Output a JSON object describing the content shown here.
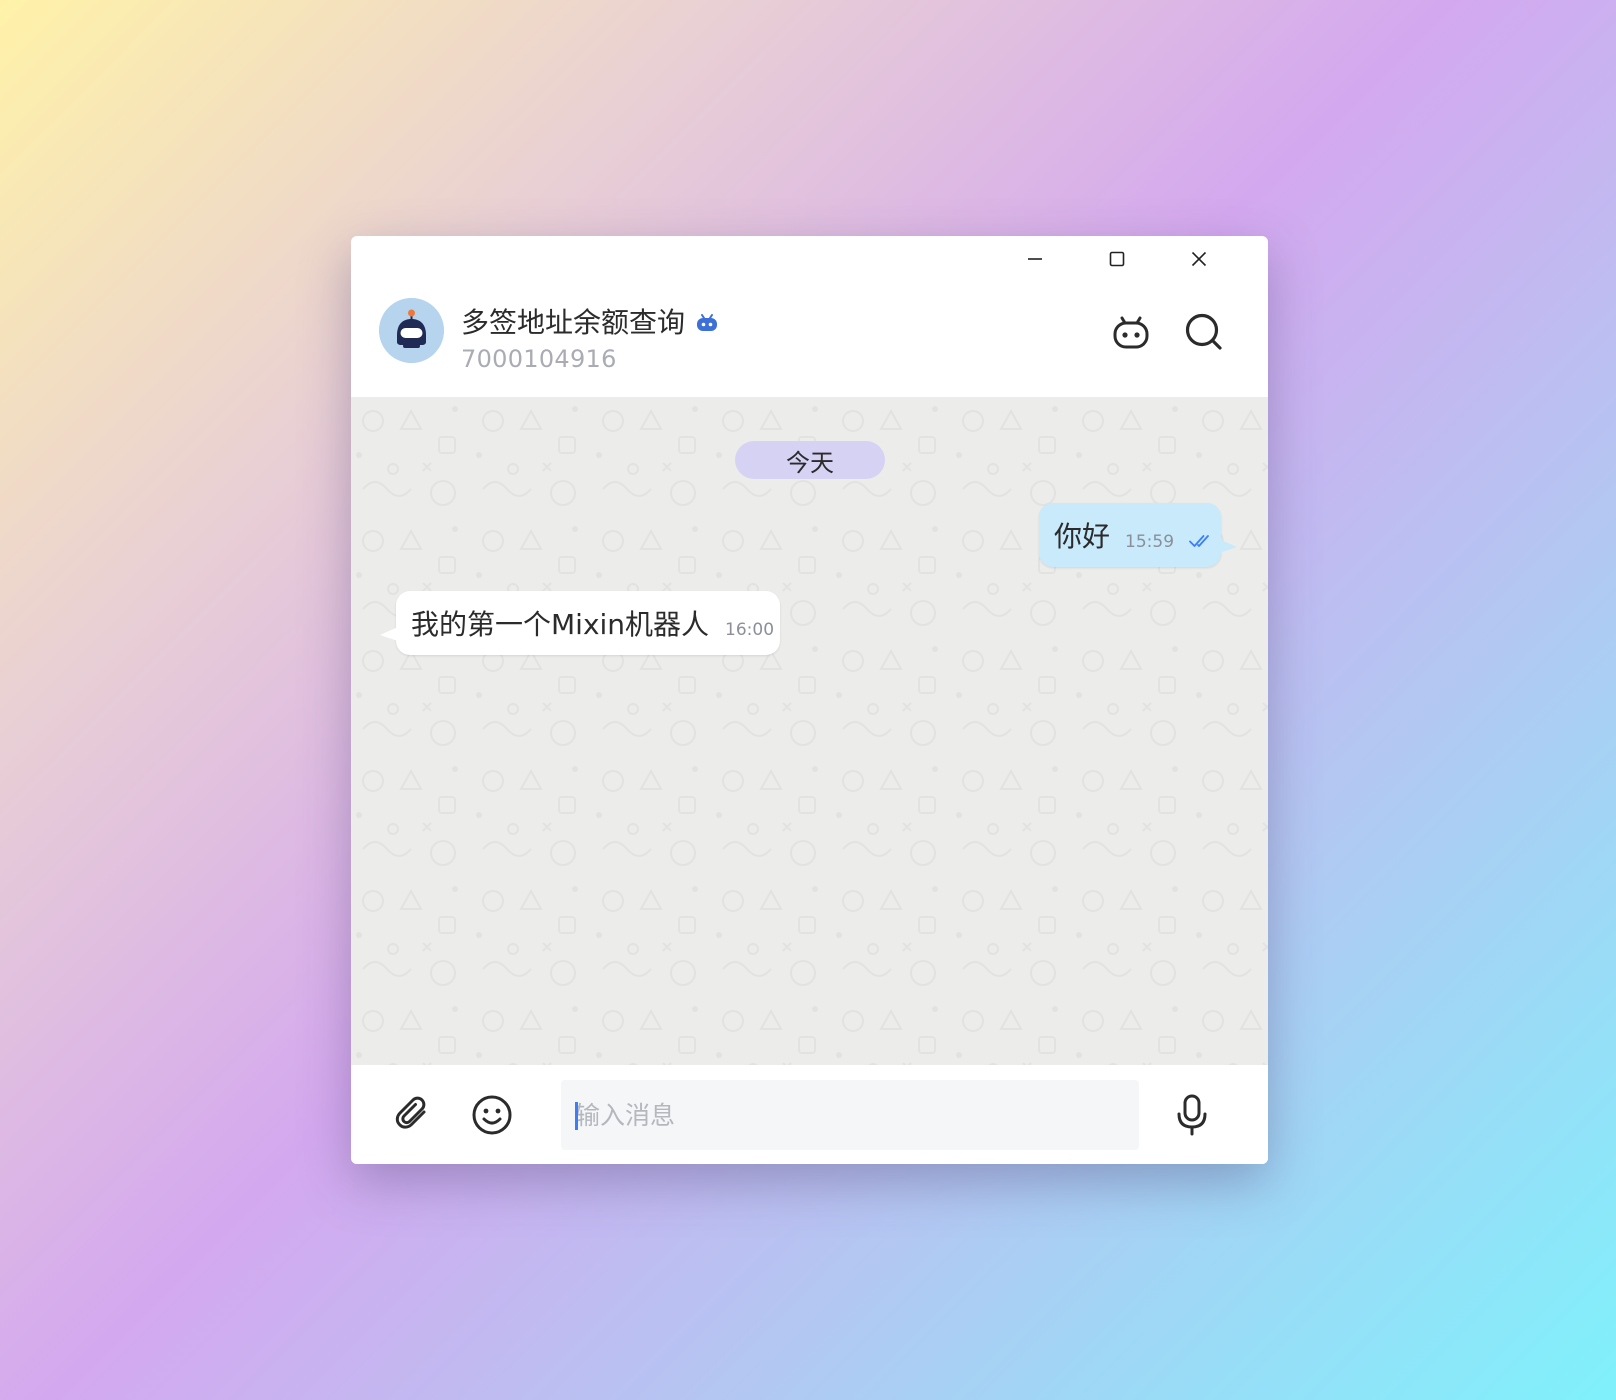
{
  "window": {
    "minimize_icon": "minimize-icon",
    "maximize_icon": "maximize-icon",
    "close_icon": "close-icon"
  },
  "header": {
    "title": "多签地址余额查询",
    "subtitle_id": "7000104916",
    "avatar_icon": "robot-avatar",
    "badge_icon": "bot-badge-icon",
    "bot_button_icon": "bot-face-icon",
    "search_button_icon": "search-icon"
  },
  "chat": {
    "date_divider": "今天",
    "messages": [
      {
        "direction": "outgoing",
        "text": "你好",
        "time": "15:59",
        "status_icon": "double-check-icon"
      },
      {
        "direction": "incoming",
        "text": "我的第一个Mixin机器人",
        "time": "16:00"
      }
    ]
  },
  "composer": {
    "attach_icon": "paperclip-icon",
    "emoji_icon": "emoji-icon",
    "input_placeholder": "输入消息",
    "input_value": "",
    "mic_icon": "microphone-icon"
  },
  "colors": {
    "outgoing_bubble": "#c8eafb",
    "incoming_bubble": "#ffffff",
    "date_pill": "#d6d2f4",
    "chat_background": "#ececeb",
    "badge_blue": "#3d6fd8",
    "tick_blue": "#3d7ef7"
  }
}
